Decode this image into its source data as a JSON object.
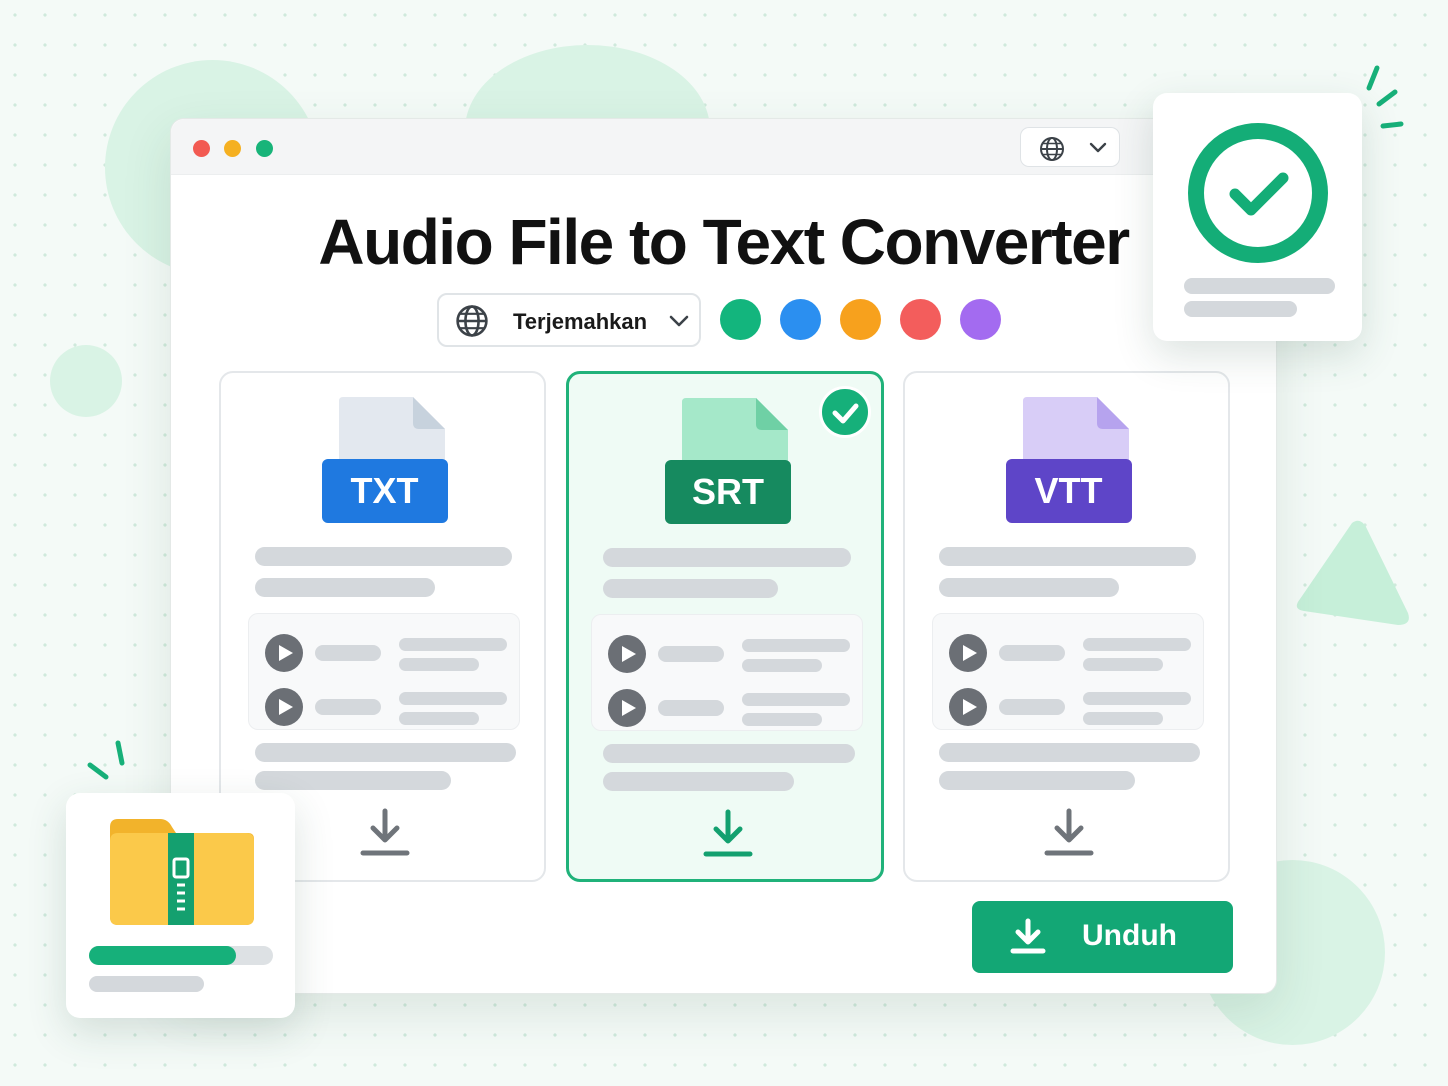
{
  "window": {
    "controls": [
      "#f25a52",
      "#f5b021",
      "#18b479"
    ],
    "language_icon": "globe-icon"
  },
  "title": "Audio File to Text Converter",
  "language": {
    "label": "Terjemahkan",
    "icon": "globe-icon"
  },
  "swatches": [
    "#13b57d",
    "#2b8ff0",
    "#f7a11d",
    "#f35d5c",
    "#a36bf0"
  ],
  "formats": [
    {
      "label": "TXT",
      "color": "#1f79e0",
      "page_color": "#e3e8ef",
      "fold_color": "#c7d2dd",
      "selected": false
    },
    {
      "label": "SRT",
      "color": "#168a5f",
      "page_color": "#a5e8c9",
      "fold_color": "#6fd0a5",
      "selected": true
    },
    {
      "label": "VTT",
      "color": "#5e45c8",
      "page_color": "#d8cdf7",
      "fold_color": "#b6a3ee",
      "selected": false
    }
  ],
  "download": {
    "label": "Unduh",
    "icon": "download-icon"
  },
  "success_card": {
    "icon": "check-circle-icon"
  },
  "archive_card": {
    "icon": "zip-folder-icon",
    "progress": 0.8
  }
}
